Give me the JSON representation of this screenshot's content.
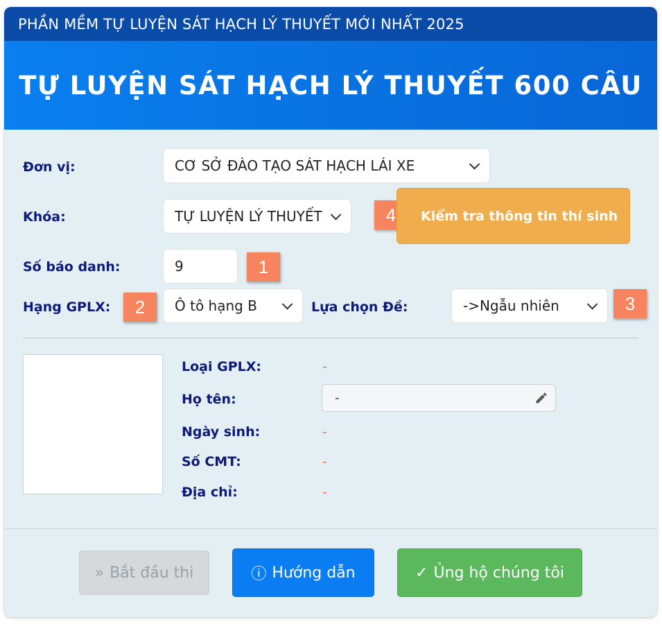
{
  "header": {
    "top_title": "PHẦN MỀM TỰ LUYỆN SÁT HẠCH LÝ THUYẾT MỚI NHẤT 2025",
    "main_title": "TỰ LUYỆN SÁT HẠCH LÝ THUYẾT 600 CÂU"
  },
  "form": {
    "don_vi": {
      "label": "Đơn vị:",
      "value": "CƠ SỞ ĐÀO TẠO SÁT HẠCH LÁI XE"
    },
    "khoa": {
      "label": "Khóa:",
      "value": "TỰ LUYỆN LÝ THUYẾT"
    },
    "so_bao_danh": {
      "label": "Số báo danh:",
      "value": "9"
    },
    "hang_gplx": {
      "label": "Hạng GPLX:",
      "value": "Ô tô hạng B"
    },
    "lua_chon_de": {
      "label": "Lựa chọn Đề:",
      "value": "->Ngẫu nhiên"
    },
    "check_button": "Kiểm tra thông tin thí sinh"
  },
  "badges": {
    "b1": "1",
    "b2": "2",
    "b3": "3",
    "b4": "4"
  },
  "candidate": {
    "loai_gplx": {
      "label": "Loại GPLX:",
      "value": "-"
    },
    "ho_ten": {
      "label": "Họ tên:",
      "value": "-"
    },
    "ngay_sinh": {
      "label": "Ngày sinh:",
      "value": "-"
    },
    "so_cmt": {
      "label": "Số CMT:",
      "value": "-"
    },
    "dia_chi": {
      "label": "Địa chỉ:",
      "value": "-"
    }
  },
  "footer": {
    "start": {
      "icon": "»",
      "label": "Bắt đầu thi"
    },
    "guide": {
      "icon": "ⓘ",
      "label": "Hướng dẫn"
    },
    "support": {
      "icon": "✓",
      "label": "Ủng hộ chúng tôi"
    }
  },
  "colors": {
    "topbar": "#0b4ba8",
    "banner": "#0a7fee",
    "label": "#0d1a78",
    "badge": "#f6845f",
    "check_button": "#f0ad4e",
    "guide_button": "#0a7df3",
    "support_button": "#5cb85c"
  }
}
